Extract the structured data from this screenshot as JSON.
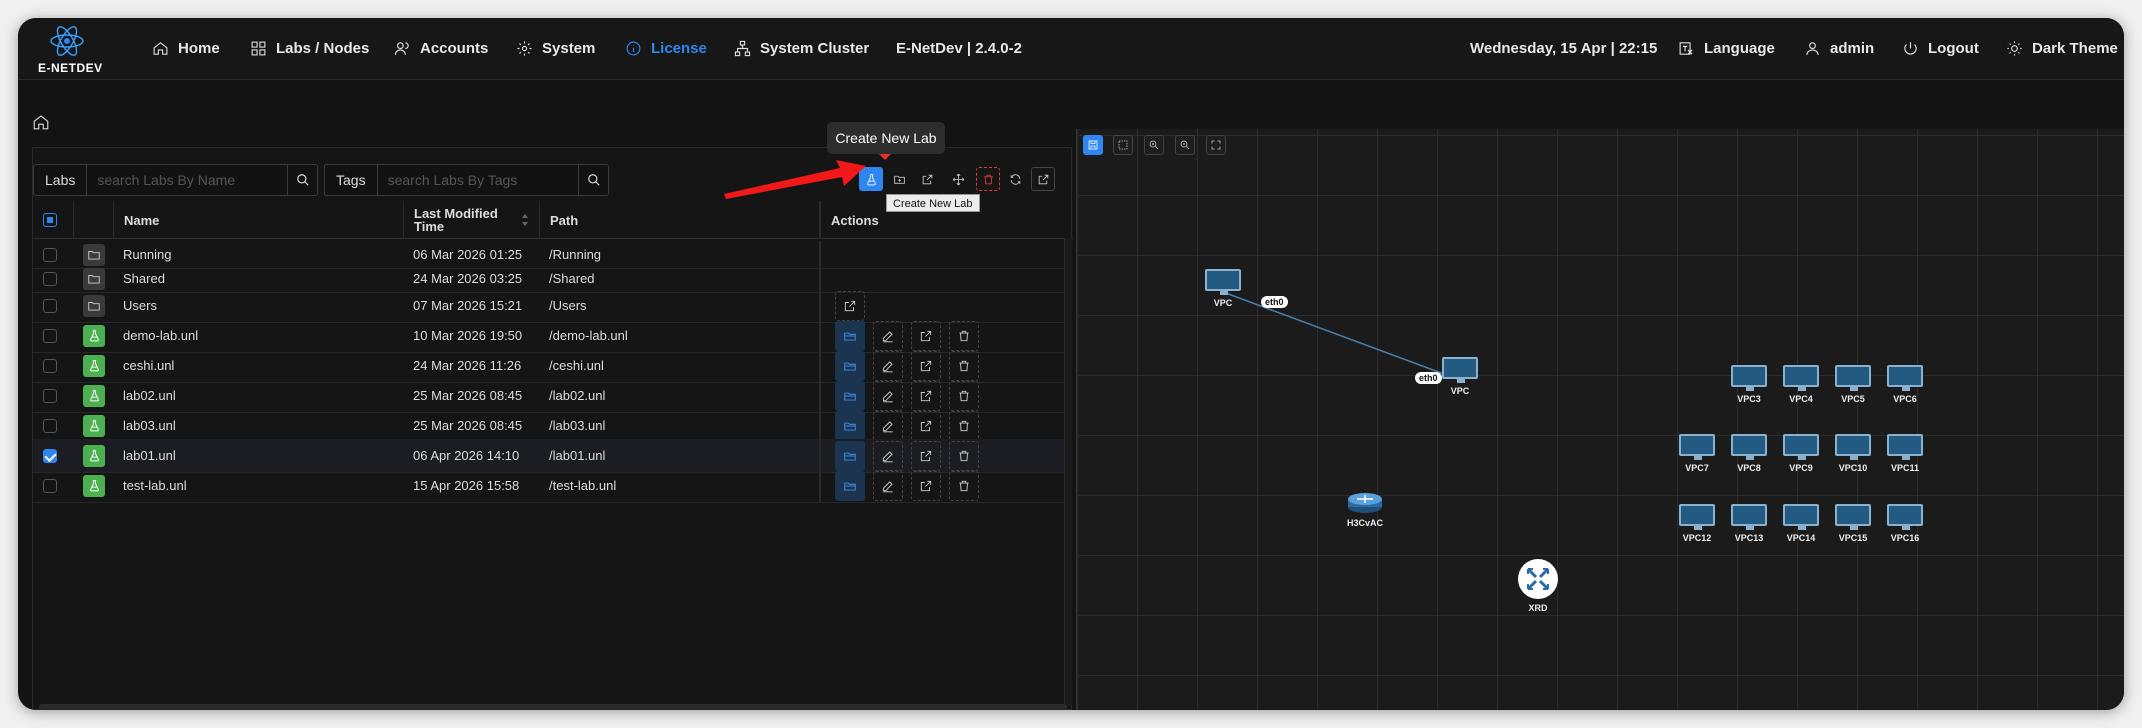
{
  "app": {
    "brand": "E-NETDEV"
  },
  "nav": {
    "home": "Home",
    "labs": "Labs / Nodes",
    "accounts": "Accounts",
    "system": "System",
    "license": "License",
    "cluster": "System Cluster",
    "version": "E-NetDev | 2.4.0-2",
    "datetime": "Wednesday, 15 Apr | 22:15",
    "language": "Language",
    "user": "admin",
    "logout": "Logout",
    "theme": "Dark Theme",
    "active_color": "#2f86f0"
  },
  "search": {
    "labs_label": "Labs",
    "labs_placeholder": "search Labs By Name",
    "tags_label": "Tags",
    "tags_placeholder": "search Labs By Tags"
  },
  "tooltip": {
    "create_lab": "Create New Lab",
    "create_lab_small": "Create New Lab"
  },
  "table": {
    "col_name": "Name",
    "col_modified_line1": "Last Modified",
    "col_modified_line2": "Time",
    "col_path": "Path",
    "col_actions": "Actions"
  },
  "rows": [
    {
      "name": "Running",
      "modified": "06 Mar 2026 01:25",
      "path": "/Running",
      "type": "folder",
      "checked": false
    },
    {
      "name": "Shared",
      "modified": "24 Mar 2026 03:25",
      "path": "/Shared",
      "type": "folder",
      "checked": false
    },
    {
      "name": "Users",
      "modified": "07 Mar 2026 15:21",
      "path": "/Users",
      "type": "folder",
      "checked": false
    },
    {
      "name": "demo-lab.unl",
      "modified": "10 Mar 2026 19:50",
      "path": "/demo-lab.unl",
      "type": "lab",
      "checked": false
    },
    {
      "name": "ceshi.unl",
      "modified": "24 Mar 2026 11:26",
      "path": "/ceshi.unl",
      "type": "lab",
      "checked": false
    },
    {
      "name": "lab02.unl",
      "modified": "25 Mar 2026 08:45",
      "path": "/lab02.unl",
      "type": "lab",
      "checked": false
    },
    {
      "name": "lab03.unl",
      "modified": "25 Mar 2026 08:45",
      "path": "/lab03.unl",
      "type": "lab",
      "checked": false
    },
    {
      "name": "lab01.unl",
      "modified": "06 Apr 2026 14:10",
      "path": "/lab01.unl",
      "type": "lab",
      "checked": true
    },
    {
      "name": "test-lab.unl",
      "modified": "15 Apr 2026 15:58",
      "path": "/test-lab.unl",
      "type": "lab",
      "checked": false
    }
  ],
  "topology": {
    "nodes": [
      {
        "label": "VPC",
        "kind": "pc"
      },
      {
        "label": "VPC",
        "kind": "pc"
      },
      {
        "label": "VPC3",
        "kind": "pc"
      },
      {
        "label": "VPC4",
        "kind": "pc"
      },
      {
        "label": "VPC5",
        "kind": "pc"
      },
      {
        "label": "VPC6",
        "kind": "pc"
      },
      {
        "label": "VPC7",
        "kind": "pc"
      },
      {
        "label": "VPC8",
        "kind": "pc"
      },
      {
        "label": "VPC9",
        "kind": "pc"
      },
      {
        "label": "VPC10",
        "kind": "pc"
      },
      {
        "label": "VPC11",
        "kind": "pc"
      },
      {
        "label": "VPC12",
        "kind": "pc"
      },
      {
        "label": "VPC13",
        "kind": "pc"
      },
      {
        "label": "VPC14",
        "kind": "pc"
      },
      {
        "label": "VPC15",
        "kind": "pc"
      },
      {
        "label": "VPC16",
        "kind": "pc"
      },
      {
        "label": "H3CvAC",
        "kind": "router"
      },
      {
        "label": "XRD",
        "kind": "xrd"
      }
    ],
    "interfaces": [
      "eth0",
      "eth0"
    ]
  }
}
